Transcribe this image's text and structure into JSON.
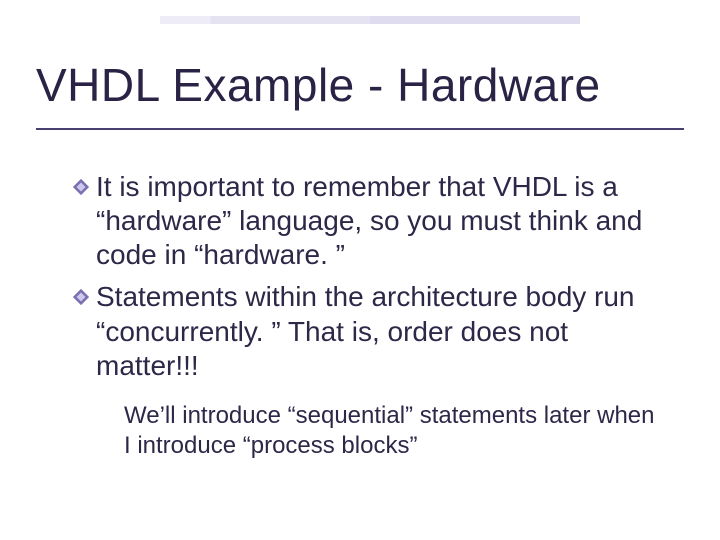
{
  "title": "VHDL Example - Hardware",
  "bullets": [
    "It is important to remember that VHDL is a “hardware” language, so you must think and code in “hardware. ”",
    "Statements within the architecture body run “concurrently. ” That is,  order does not matter!!!"
  ],
  "subbullets": [
    "We’ll introduce “sequential” statements later when I introduce “process blocks”"
  ],
  "colors": {
    "text": "#2b2346",
    "rule": "#4a3f72",
    "bullet_outer": "#7a6fb0",
    "bullet_inner": "#b9b0dd",
    "subbullet": "#8a7fbf"
  }
}
